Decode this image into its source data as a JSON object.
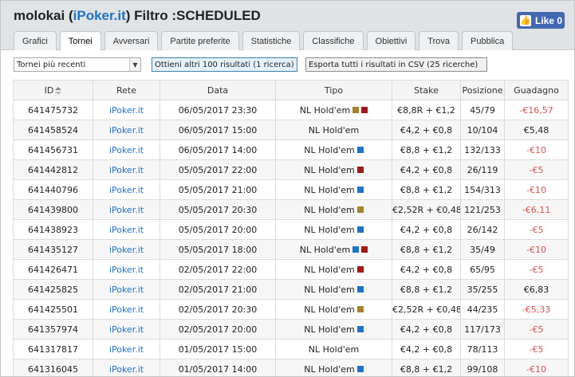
{
  "header": {
    "user": "molokai",
    "site": "iPoker.it",
    "filter_label": "Filtro :SCHEDULED",
    "like_label": "Like 0"
  },
  "tabs": [
    "Grafici",
    "Tornei",
    "Avversari",
    "Partite preferite",
    "Statistiche",
    "Classifiche",
    "Obiettivi",
    "Trova",
    "Pubblica"
  ],
  "toolbar": {
    "select_value": "Tornei più recenti",
    "more_results_label": "Ottieni altri 100 risultati (1 ricerca)",
    "export_label": "Esporta tutti i risultati in CSV (25  ricerche)"
  },
  "table": {
    "columns": [
      "ID",
      "Rete",
      "Data",
      "Tipo",
      "Stake",
      "Posizione",
      "Guadagno"
    ],
    "rows": [
      {
        "id": "641475732",
        "rete": "iPoker.it",
        "data": "06/05/2017 23:30",
        "tipo": "NL Hold'em",
        "badges": [
          "P",
          "T"
        ],
        "stake": "€8,8R + €1,2",
        "pos": "45/79",
        "guadagno": "-€16,57",
        "neg": true
      },
      {
        "id": "641458524",
        "rete": "iPoker.it",
        "data": "06/05/2017 15:00",
        "tipo": "NL Hold'em",
        "badges": [],
        "stake": "€4,2 + €0,8",
        "pos": "10/104",
        "guadagno": "€5,48",
        "neg": false
      },
      {
        "id": "641456731",
        "rete": "iPoker.it",
        "data": "06/05/2017 14:00",
        "tipo": "NL Hold'em",
        "badges": [
          "S"
        ],
        "stake": "€8,8 + €1,2",
        "pos": "132/133",
        "guadagno": "-€10",
        "neg": true
      },
      {
        "id": "641442812",
        "rete": "iPoker.it",
        "data": "05/05/2017 22:00",
        "tipo": "NL Hold'em",
        "badges": [
          "T"
        ],
        "stake": "€4,2 + €0,8",
        "pos": "26/119",
        "guadagno": "-€5",
        "neg": true
      },
      {
        "id": "641440796",
        "rete": "iPoker.it",
        "data": "05/05/2017 21:00",
        "tipo": "NL Hold'em",
        "badges": [
          "S"
        ],
        "stake": "€8,8 + €1,2",
        "pos": "154/313",
        "guadagno": "-€10",
        "neg": true
      },
      {
        "id": "641439800",
        "rete": "iPoker.it",
        "data": "05/05/2017 20:30",
        "tipo": "NL Hold'em",
        "badges": [
          "P"
        ],
        "stake": "€2,52R + €0,48",
        "pos": "121/253",
        "guadagno": "-€6,11",
        "neg": true
      },
      {
        "id": "641438923",
        "rete": "iPoker.it",
        "data": "05/05/2017 20:00",
        "tipo": "NL Hold'em",
        "badges": [
          "S"
        ],
        "stake": "€4,2 + €0,8",
        "pos": "26/142",
        "guadagno": "-€5",
        "neg": true
      },
      {
        "id": "641435127",
        "rete": "iPoker.it",
        "data": "05/05/2017 18:00",
        "tipo": "NL Hold'em",
        "badges": [
          "S",
          "T"
        ],
        "stake": "€8,8 + €1,2",
        "pos": "35/49",
        "guadagno": "-€10",
        "neg": true
      },
      {
        "id": "641426471",
        "rete": "iPoker.it",
        "data": "02/05/2017 22:00",
        "tipo": "NL Hold'em",
        "badges": [
          "T"
        ],
        "stake": "€4,2 + €0,8",
        "pos": "65/95",
        "guadagno": "-€5",
        "neg": true
      },
      {
        "id": "641425825",
        "rete": "iPoker.it",
        "data": "02/05/2017 21:00",
        "tipo": "NL Hold'em",
        "badges": [
          "S"
        ],
        "stake": "€8,8 + €1,2",
        "pos": "35/255",
        "guadagno": "€6,83",
        "neg": false
      },
      {
        "id": "641425501",
        "rete": "iPoker.it",
        "data": "02/05/2017 20:30",
        "tipo": "NL Hold'em",
        "badges": [
          "P"
        ],
        "stake": "€2,52R + €0,48",
        "pos": "44/235",
        "guadagno": "-€5,33",
        "neg": true
      },
      {
        "id": "641357974",
        "rete": "iPoker.it",
        "data": "02/05/2017 20:00",
        "tipo": "NL Hold'em",
        "badges": [
          "S"
        ],
        "stake": "€4,2 + €0,8",
        "pos": "117/173",
        "guadagno": "-€5",
        "neg": true
      },
      {
        "id": "641317817",
        "rete": "iPoker.it",
        "data": "01/05/2017 15:00",
        "tipo": "NL Hold'em",
        "badges": [],
        "stake": "€4,2 + €0,8",
        "pos": "78/113",
        "guadagno": "-€5",
        "neg": true
      },
      {
        "id": "641316045",
        "rete": "iPoker.it",
        "data": "01/05/2017 14:00",
        "tipo": "NL Hold'em",
        "badges": [
          "S"
        ],
        "stake": "€8,8 + €1,2",
        "pos": "99/108",
        "guadagno": "-€10",
        "neg": true
      }
    ]
  },
  "colors": {
    "link": "#1f73c7",
    "negative": "#d9534f",
    "header_bg": "#dfe3e6",
    "facebook": "#4267b2"
  }
}
